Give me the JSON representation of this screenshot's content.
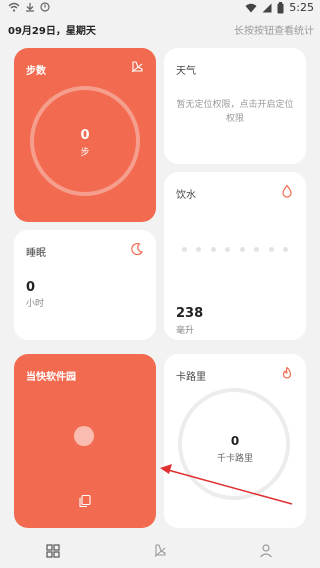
{
  "status_bar": {
    "time": "5:25",
    "left_icons": [
      "wifi-icon",
      "download-icon",
      "notification-icon"
    ],
    "right_icons": [
      "wifi-signal-icon",
      "signal-icon",
      "battery-icon"
    ]
  },
  "header": {
    "date": "09月29日，星期天",
    "hint": "长按按钮查看统计"
  },
  "cards": {
    "steps": {
      "title": "步数",
      "value": "0",
      "unit": "步",
      "icon": "shoe-icon"
    },
    "weather": {
      "title": "天气",
      "message": "暂无定位权限，点击开启定位权限"
    },
    "water": {
      "title": "饮水",
      "value": "238",
      "unit": "毫升",
      "icon": "water-drop-icon"
    },
    "sleep": {
      "title": "睡眠",
      "value": "0",
      "unit": "小时",
      "icon": "moon-icon"
    },
    "app": {
      "title": "当快软件园",
      "icon": "copy-icon"
    },
    "calories": {
      "title": "卡路里",
      "value": "0",
      "unit": "千卡路里",
      "icon": "flame-icon"
    }
  },
  "bottom_nav": {
    "items": [
      "grid-icon",
      "shoe-icon",
      "person-icon"
    ]
  },
  "colors": {
    "accent": "#f26b50",
    "background": "#f2f2f2",
    "card": "#ffffff",
    "annotation": "#e03030"
  }
}
